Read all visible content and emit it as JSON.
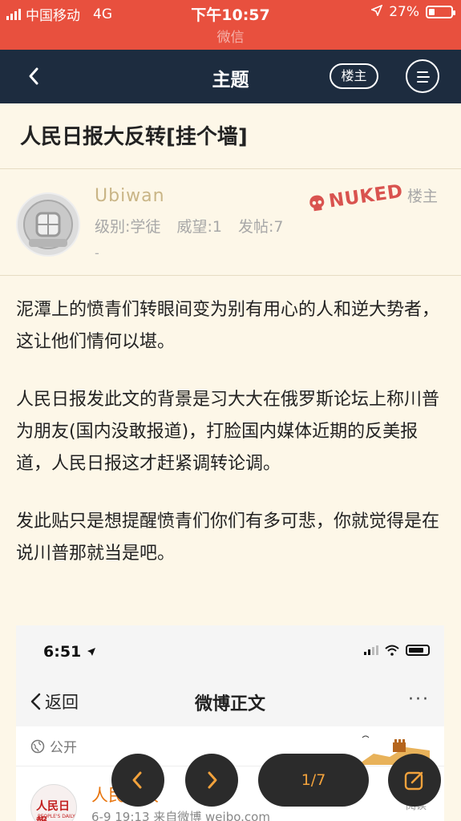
{
  "status_bar": {
    "carrier": "中国移动",
    "network": "4G",
    "time": "下午10:57",
    "battery": "27%",
    "battery_level": 0.27,
    "subtitle": "微信"
  },
  "nav": {
    "title": "主题",
    "owner_button": "楼主"
  },
  "topic": {
    "title": "人民日报大反转[挂个墙]"
  },
  "author": {
    "name": "Ubiwan",
    "level": "级别:学徒",
    "prestige": "威望:1",
    "posts": "发帖:7",
    "extra": "-",
    "badge": "NUKED",
    "role": "楼主"
  },
  "post": {
    "paragraphs": [
      "泥潭上的愤青们转眼间变为别有用心的人和逆大势者，这让他们情何以堪。",
      "人民日报发此文的背景是习大大在俄罗斯论坛上称川普为朋友(国内没敢报道)，打脸国内媒体近期的反美报道，人民日报这才赶紧调转论调。",
      "发此贴只是想提醒愤青们你们有多可悲，你就觉得是在说川普那就当是吧。"
    ]
  },
  "embedded": {
    "time": "6:51",
    "back": "返回",
    "title": "微博正文",
    "more": "···",
    "visibility": "公开",
    "account_name": "人民日报",
    "datetime": "6-9 19:13  来自微博 weibo.com",
    "read": "阅读",
    "avatar_logo": "人民日報",
    "avatar_logo_en": "PEOPLE'S DAILY"
  },
  "controls": {
    "page_indicator": "1/7"
  },
  "colors": {
    "status_bar": "#e8503e",
    "nav_bar": "#1d2c3f",
    "background": "#fdf7e8",
    "author_name": "#c9b586",
    "nuked": "#d9534f",
    "page_indicator": "#f2a23c"
  }
}
